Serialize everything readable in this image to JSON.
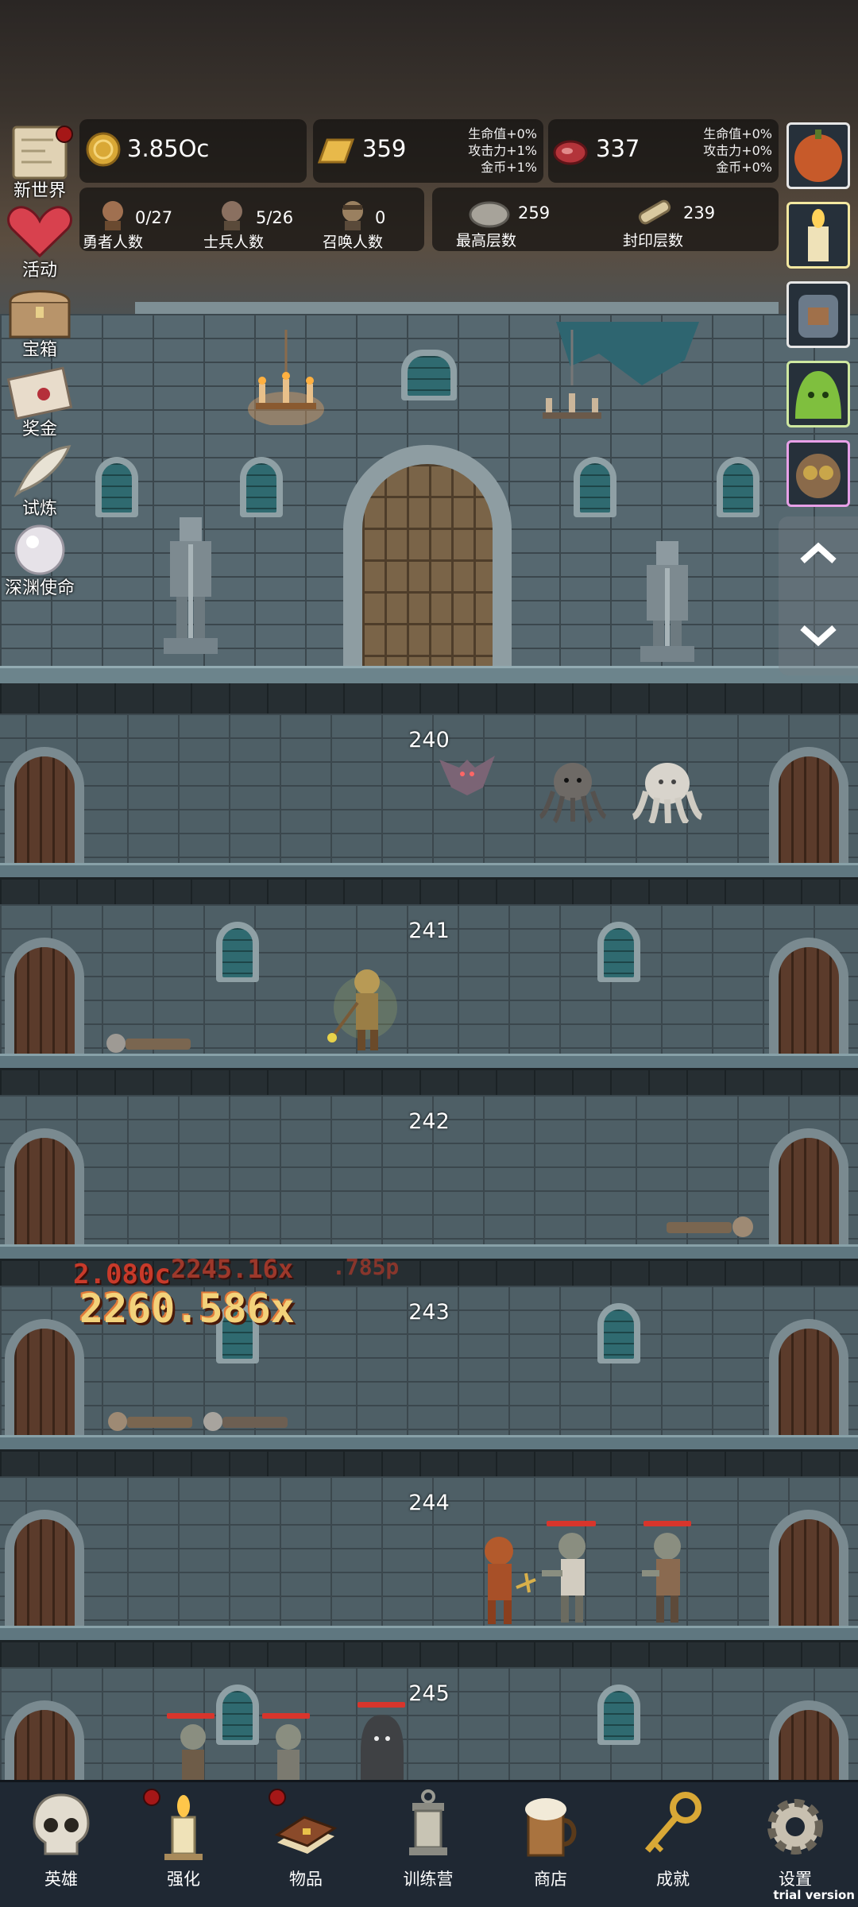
{
  "hud": {
    "gold": "3.85Oc",
    "gold_bar": "359",
    "gold_bar_bonus": [
      "生命值+0%",
      "攻击力+1%",
      "金币+1%"
    ],
    "meat": "337",
    "meat_bonus": [
      "生命值+0%",
      "攻击力+0%",
      "金币+0%"
    ],
    "hero_count": "0/27",
    "hero_label": "勇者人数",
    "soldier_count": "5/26",
    "soldier_label": "士兵人数",
    "summon_count": "0",
    "summon_label": "召唤人数",
    "max_floor": "259",
    "max_floor_label": "最高层数",
    "sealed_floor": "239",
    "sealed_floor_label": "封印层数"
  },
  "left_menu": [
    {
      "label": "新世界"
    },
    {
      "label": "活动"
    },
    {
      "label": "宝箱"
    },
    {
      "label": "奖金"
    },
    {
      "label": "试炼"
    },
    {
      "label": "深渊使命"
    }
  ],
  "floors": [
    "240",
    "241",
    "242",
    "243",
    "244",
    "245"
  ],
  "damage": {
    "main": "2260.586x",
    "back1": "2.080c",
    "back2": "2245.16x",
    "back3": ".785p"
  },
  "nav": [
    {
      "label": "英雄",
      "icon": "skull-icon"
    },
    {
      "label": "强化",
      "icon": "candle-icon"
    },
    {
      "label": "物品",
      "icon": "book-icon"
    },
    {
      "label": "训练营",
      "icon": "lantern-icon"
    },
    {
      "label": "商店",
      "icon": "beer-mug-icon"
    },
    {
      "label": "成就",
      "icon": "key-icon"
    },
    {
      "label": "设置",
      "icon": "gear-icon"
    }
  ],
  "watermark": "trial version"
}
